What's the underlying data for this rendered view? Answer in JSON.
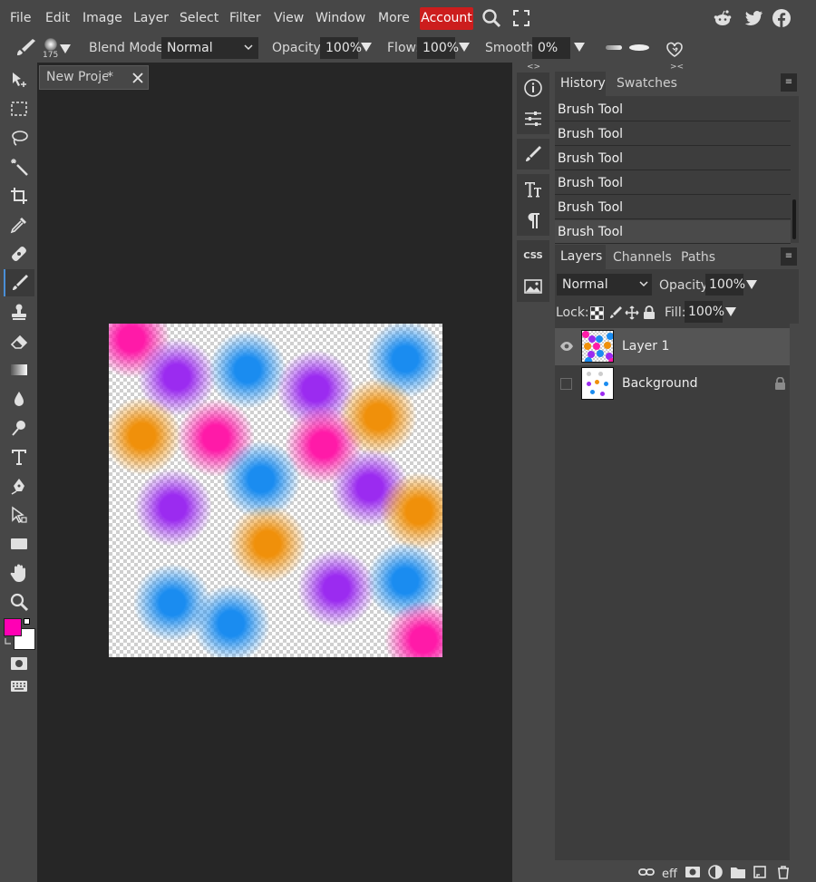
{
  "menubar": {
    "items": [
      "File",
      "Edit",
      "Image",
      "Layer",
      "Select",
      "Filter",
      "View",
      "Window",
      "More"
    ],
    "account_label": "Account"
  },
  "options": {
    "brush_size": "175",
    "blend_mode_label": "Blend Mode:",
    "blend_mode_value": "Normal",
    "opacity_label": "Opacity:",
    "opacity_value": "100%",
    "flow_label": "Flow:",
    "flow_value": "100%",
    "smooth_label": "Smooth:",
    "smooth_value": "0%"
  },
  "document": {
    "tab_title": "New Projec",
    "tab_modified": " *"
  },
  "colors": {
    "accent_red": "#cc1d1d",
    "foreground": "#ff00b4",
    "background": "#ffffff",
    "dot_pink": "#ff1aa8",
    "dot_purple": "#9b2bf0",
    "dot_blue": "#1a8cf0",
    "dot_orange": "#f0900a"
  },
  "history": {
    "tabs": [
      "History",
      "Swatches"
    ],
    "items": [
      "Brush Tool",
      "Brush Tool",
      "Brush Tool",
      "Brush Tool",
      "Brush Tool",
      "Brush Tool"
    ]
  },
  "layers": {
    "tabs": [
      "Layers",
      "Channels",
      "Paths"
    ],
    "blend_mode": "Normal",
    "opacity_label": "Opacity:",
    "opacity_value": "100%",
    "lock_label": "Lock:",
    "fill_label": "Fill:",
    "fill_value": "100%",
    "items": [
      {
        "name": "Layer 1",
        "visible": true,
        "selected": true
      },
      {
        "name": "Background",
        "visible": false,
        "locked": true
      }
    ]
  },
  "strip": {
    "css_label": "CSS"
  }
}
